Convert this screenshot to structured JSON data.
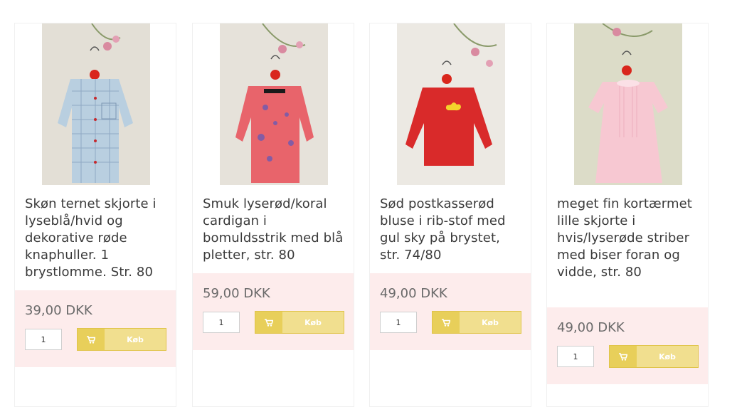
{
  "products": [
    {
      "title": "Skøn ternet skjorte i lyseblå/hvid og dekorative røde knaphuller. 1 brystlomme. Str. 80",
      "price": "39,00 DKK",
      "quantity": "1",
      "buy_label": "Køb",
      "garment_color": "#b9cfe0"
    },
    {
      "title": "Smuk lyserød/koral cardigan i bomuldsstrik med blå pletter, str. 80",
      "price": "59,00 DKK",
      "quantity": "1",
      "buy_label": "Køb",
      "garment_color": "#e8646b"
    },
    {
      "title": "Sød postkasserød bluse i rib-stof med gul sky på brystet, str. 74/80",
      "price": "49,00 DKK",
      "quantity": "1",
      "buy_label": "Køb",
      "garment_color": "#d92a2a"
    },
    {
      "title": "meget fin kortærmet lille skjorte i hvis/lyserøde striber med biser foran og vidde, str. 80",
      "price": "49,00 DKK",
      "quantity": "1",
      "buy_label": "Køb",
      "garment_color": "#f7c8d2"
    }
  ],
  "colors": {
    "buy_area_bg": "#fdecec",
    "button_bg": "#f1df8f",
    "button_cart_bg": "#e8cf5a",
    "title_text": "#3a3a3a",
    "price_text": "#6a6a6a"
  }
}
